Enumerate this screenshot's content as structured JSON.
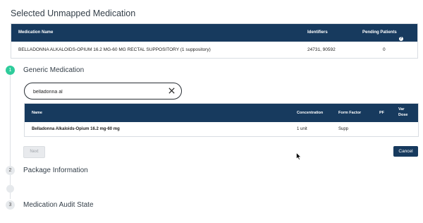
{
  "header": {
    "title": "Selected Unmapped Medication"
  },
  "unmapped_table": {
    "columns": [
      "Medication Name",
      "Identifiers",
      "Pending Patients"
    ],
    "row": {
      "name": "BELLADONNA ALKALOIDS-OPIUM 16.2 MG-60 MG RECTAL SUPPOSITORY (1 suppository)",
      "identifiers": "24731, 90592",
      "pending": "0"
    },
    "help_icon": "question-circle-icon"
  },
  "steps": [
    {
      "number": "1",
      "label": "Generic Medication",
      "status": "active"
    },
    {
      "number": "2",
      "label": "Package Information",
      "status": "inactive"
    },
    {
      "number": "3",
      "label": "Medication Audit State",
      "status": "inactive"
    }
  ],
  "search": {
    "value": "belladonna al",
    "clear_icon": "close-icon"
  },
  "results_table": {
    "columns": {
      "name": "Name",
      "concentration": "Concentration",
      "form_factor": "Form Factor",
      "pf": "PF",
      "var_dose_1": "Var",
      "var_dose_2": "Dose"
    },
    "rows": [
      {
        "name": "Belladonna Alkaloids-Opium 16.2 mg-60 mg",
        "concentration": "1 unit",
        "form_factor": "Supp",
        "pf": "",
        "var_dose": ""
      }
    ]
  },
  "buttons": {
    "next": "Next",
    "cancel": "Cancel"
  },
  "colors": {
    "header_bg": "#173a5e",
    "active_step": "#2ecc9b",
    "primary_button": "#173a5e"
  }
}
